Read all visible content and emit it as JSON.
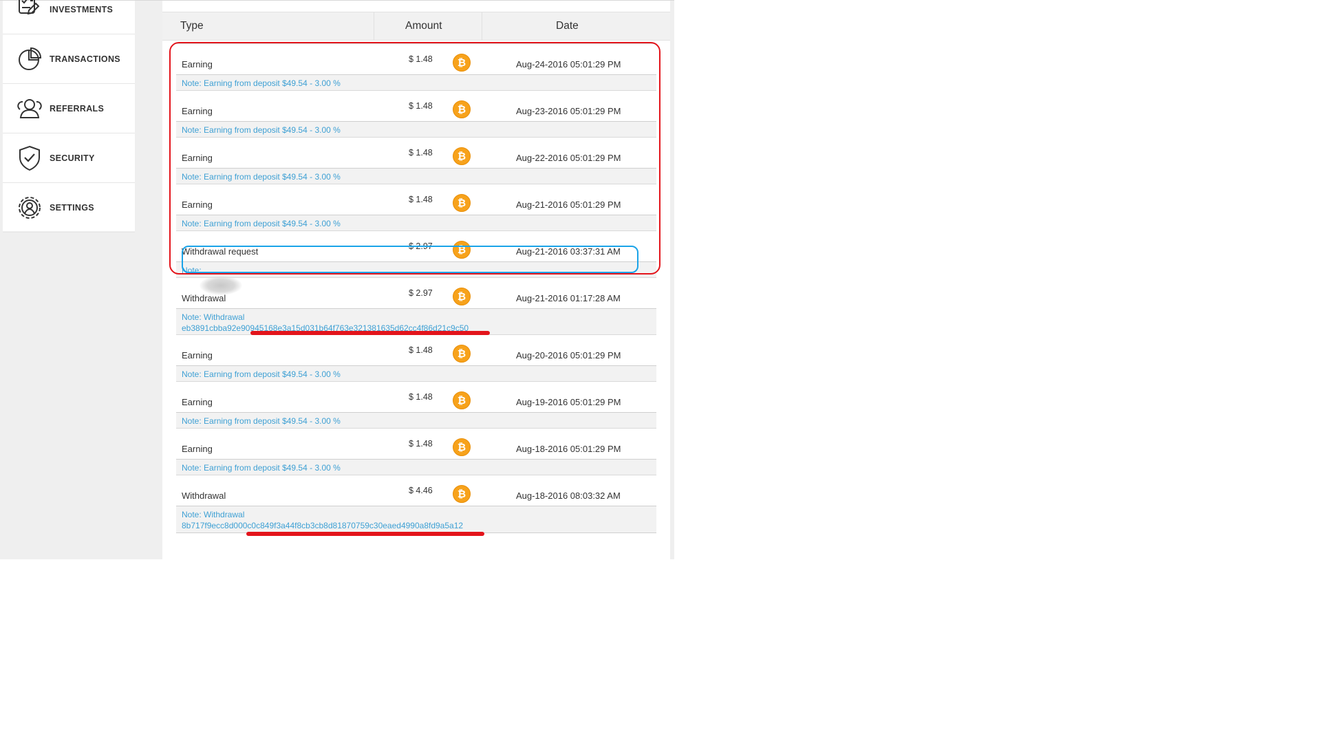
{
  "sidebar": {
    "items": [
      {
        "label": "INVESTMENTS",
        "icon": "checklist-icon"
      },
      {
        "label": "TRANSACTIONS",
        "icon": "pie-chart-icon"
      },
      {
        "label": "REFERRALS",
        "icon": "users-icon"
      },
      {
        "label": "SECURITY",
        "icon": "shield-check-icon"
      },
      {
        "label": "SETTINGS",
        "icon": "gear-user-icon"
      }
    ]
  },
  "table": {
    "headers": {
      "type": "Type",
      "amount": "Amount",
      "date": "Date"
    },
    "coin_glyph": "₿",
    "rows": [
      {
        "type": "Earning",
        "amount": "$ 1.48",
        "date": "Aug-24-2016 05:01:29 PM",
        "note": "Note: Earning from deposit $49.54 - 3.00 %"
      },
      {
        "type": "Earning",
        "amount": "$ 1.48",
        "date": "Aug-23-2016 05:01:29 PM",
        "note": "Note: Earning from deposit $49.54 - 3.00 %"
      },
      {
        "type": "Earning",
        "amount": "$ 1.48",
        "date": "Aug-22-2016 05:01:29 PM",
        "note": "Note: Earning from deposit $49.54 - 3.00 %"
      },
      {
        "type": "Earning",
        "amount": "$ 1.48",
        "date": "Aug-21-2016 05:01:29 PM",
        "note": "Note: Earning from deposit $49.54 - 3.00 %"
      },
      {
        "type": "Withdrawal request",
        "amount": "$ 2.97",
        "date": "Aug-21-2016 03:37:31 AM",
        "note": "Note:"
      },
      {
        "type": "Withdrawal",
        "amount": "$ 2.97",
        "date": "Aug-21-2016 01:17:28 AM",
        "note": "Note: Withdrawal",
        "note_line2": "eb3891cbba92e90945168e3a15d031b64f763e321381635d62cc4f86d21c9c50"
      },
      {
        "type": "Earning",
        "amount": "$ 1.48",
        "date": "Aug-20-2016 05:01:29 PM",
        "note": "Note: Earning from deposit $49.54 - 3.00 %"
      },
      {
        "type": "Earning",
        "amount": "$ 1.48",
        "date": "Aug-19-2016 05:01:29 PM",
        "note": "Note: Earning from deposit $49.54 - 3.00 %"
      },
      {
        "type": "Earning",
        "amount": "$ 1.48",
        "date": "Aug-18-2016 05:01:29 PM",
        "note": "Note: Earning from deposit $49.54 - 3.00 %"
      },
      {
        "type": "Withdrawal",
        "amount": "$ 4.46",
        "date": "Aug-18-2016 08:03:32 AM",
        "note": "Note: Withdrawal",
        "note_line2": "8b717f9ecc8d000c0c849f3a44f8cb3cb8d81870759c30eaed4990a8fd9a5a12"
      }
    ]
  },
  "colors": {
    "highlight_red": "#e3141b",
    "highlight_blue": "#1aa3e8",
    "note_text": "#3ea0d4",
    "bitcoin": "#f7a21b"
  }
}
